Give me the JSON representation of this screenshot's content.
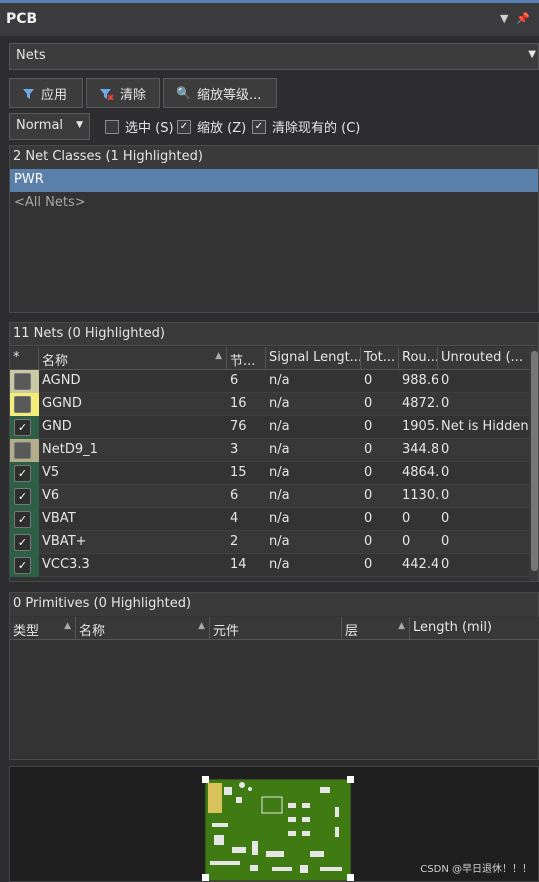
{
  "panel": {
    "title": "PCB"
  },
  "mode_dropdown": {
    "value": "Nets"
  },
  "toolbar": {
    "apply_label": "应用",
    "clear_label": "清除",
    "zoom_level_label": "缩放等级..."
  },
  "options": {
    "display_mode": "Normal",
    "select_label": "选中 (S)",
    "select_checked": false,
    "zoom_label": "缩放 (Z)",
    "zoom_checked": true,
    "clear_existing_label": "清除现有的 (C)",
    "clear_existing_checked": true
  },
  "net_classes": {
    "header": "2 Net Classes (1 Highlighted)",
    "items": [
      {
        "label": "PWR",
        "selected": true
      },
      {
        "label": "<All Nets>",
        "selected": false
      }
    ]
  },
  "nets": {
    "header": "11 Nets (0 Highlighted)",
    "columns": [
      "*",
      "名称",
      "节...",
      "Signal Lengt...",
      "Tot...",
      "Rou...",
      "Unrouted (..."
    ],
    "rows": [
      {
        "color": "#c9c9a6",
        "checked": false,
        "name": "AGND",
        "nodes": "6",
        "signal": "n/a",
        "total": "0",
        "routed": "988.6",
        "unrouted": "0"
      },
      {
        "color": "#f2ee79",
        "checked": false,
        "name": "GGND",
        "nodes": "16",
        "signal": "n/a",
        "total": "0",
        "routed": "4872.",
        "unrouted": "0"
      },
      {
        "color": "#2e5f45",
        "checked": true,
        "name": "GND",
        "nodes": "76",
        "signal": "n/a",
        "total": "0",
        "routed": "1905.",
        "unrouted": "Net is Hidden"
      },
      {
        "color": "#b2ae8b",
        "checked": false,
        "name": "NetD9_1",
        "nodes": "3",
        "signal": "n/a",
        "total": "0",
        "routed": "344.8",
        "unrouted": "0"
      },
      {
        "color": "#2e5f45",
        "checked": true,
        "name": "V5",
        "nodes": "15",
        "signal": "n/a",
        "total": "0",
        "routed": "4864.",
        "unrouted": "0"
      },
      {
        "color": "#2e5f45",
        "checked": true,
        "name": "V6",
        "nodes": "6",
        "signal": "n/a",
        "total": "0",
        "routed": "1130.",
        "unrouted": "0"
      },
      {
        "color": "#2e5f45",
        "checked": true,
        "name": "VBAT",
        "nodes": "4",
        "signal": "n/a",
        "total": "0",
        "routed": "0",
        "unrouted": "0"
      },
      {
        "color": "#2e5f45",
        "checked": true,
        "name": "VBAT+",
        "nodes": "2",
        "signal": "n/a",
        "total": "0",
        "routed": "0",
        "unrouted": "0"
      },
      {
        "color": "#2e5f45",
        "checked": true,
        "name": "VCC3.3",
        "nodes": "14",
        "signal": "n/a",
        "total": "0",
        "routed": "442.4",
        "unrouted": "0"
      }
    ]
  },
  "primitives": {
    "header": "0 Primitives (0 Highlighted)",
    "columns": [
      "类型",
      "名称",
      "元件",
      "层",
      "Length (mil)"
    ]
  },
  "watermark": "CSDN @早日退休！！！",
  "colors": {
    "accent": "#5a7fa8",
    "panel_bg": "#2d2d30",
    "pcb_green": "#3f7a12"
  }
}
